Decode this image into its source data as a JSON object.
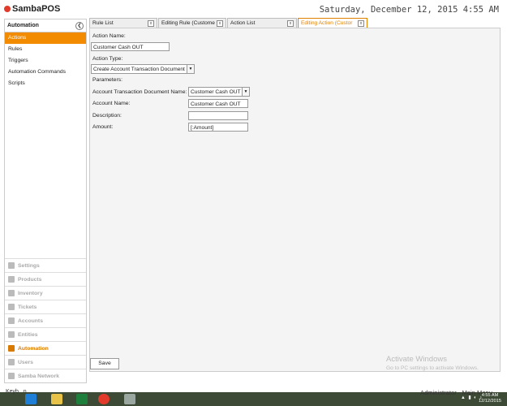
{
  "app": {
    "logo": "SambaPOS",
    "clock": "Saturday, December 12, 2015 4:55 AM"
  },
  "sidebar": {
    "title": "Automation",
    "items": [
      {
        "label": "Actions"
      },
      {
        "label": "Rules"
      },
      {
        "label": "Triggers"
      },
      {
        "label": "Automation Commands"
      },
      {
        "label": "Scripts"
      }
    ]
  },
  "modules": [
    {
      "label": "Settings",
      "icon": "gear-icon"
    },
    {
      "label": "Products",
      "icon": "cup-icon"
    },
    {
      "label": "Inventory",
      "icon": "box-icon"
    },
    {
      "label": "Tickets",
      "icon": "ticket-icon"
    },
    {
      "label": "Accounts",
      "icon": "ledger-icon"
    },
    {
      "label": "Entities",
      "icon": "grid-icon"
    },
    {
      "label": "Automation",
      "icon": "pencil-icon"
    },
    {
      "label": "Users",
      "icon": "users-icon"
    },
    {
      "label": "Samba Network",
      "icon": "globe-icon"
    }
  ],
  "tabs": [
    {
      "label": "Rule List"
    },
    {
      "label": "Editing Rule (Custome"
    },
    {
      "label": "Action List"
    },
    {
      "label": "Editing Action (Custor"
    }
  ],
  "form": {
    "action_name_label": "Action Name:",
    "action_name_value": "Customer Cash OUT",
    "action_type_label": "Action Type:",
    "action_type_value": "Create Account Transaction Document",
    "parameters_label": "Parameters:",
    "doc_name_label": "Account Transaction Document Name:",
    "doc_name_value": "Customer Cash OUT",
    "account_name_label": "Account Name:",
    "account_name_value": "Customer Cash OUT",
    "description_label": "Description:",
    "description_value": "",
    "amount_label": "Amount:",
    "amount_value": "[:Amount]",
    "save_label": "Save"
  },
  "watermark": {
    "title": "Activate Windows",
    "subtitle": "Go to PC settings to activate Windows."
  },
  "status": {
    "keyboard": "Keyb...n",
    "user": "Administrator - Main Menu"
  },
  "taskbar": {
    "time": "4:55 AM",
    "date": "12/12/2015"
  }
}
